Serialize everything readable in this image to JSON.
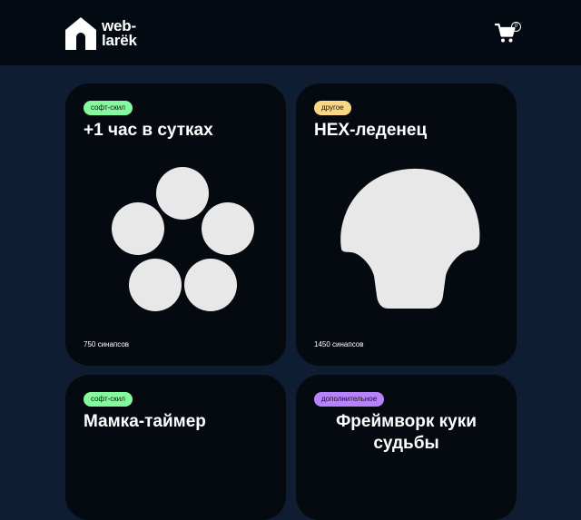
{
  "header": {
    "logo_text_line1": "web-",
    "logo_text_line2": "larёk",
    "basket_icon": "shopping-cart-icon",
    "basket_count": "0"
  },
  "colors": {
    "page_bg": "#0f1d33",
    "header_bg": "#040a12",
    "card_bg": "#050a11",
    "category_soft": "#83fa9d",
    "category_other": "#fad883",
    "category_additional": "#b783fa",
    "image_fill": "#e8e8e8"
  },
  "gallery": {
    "cards": [
      {
        "category": "софт-скил",
        "category_color": "#83fa9d",
        "title": "+1 час в сутках",
        "image": "five-circles-image",
        "price": "750 синапсов"
      },
      {
        "category": "другое",
        "category_color": "#fad883",
        "title": "HEX-леденец",
        "image": "shell-shape-image",
        "price": "1450 синапсов"
      },
      {
        "category": "софт-скил",
        "category_color": "#83fa9d",
        "title": "Мамка-таймер"
      },
      {
        "category": "дополнительное",
        "category_color": "#b783fa",
        "title": "Фреймворк куки судьбы"
      }
    ]
  }
}
